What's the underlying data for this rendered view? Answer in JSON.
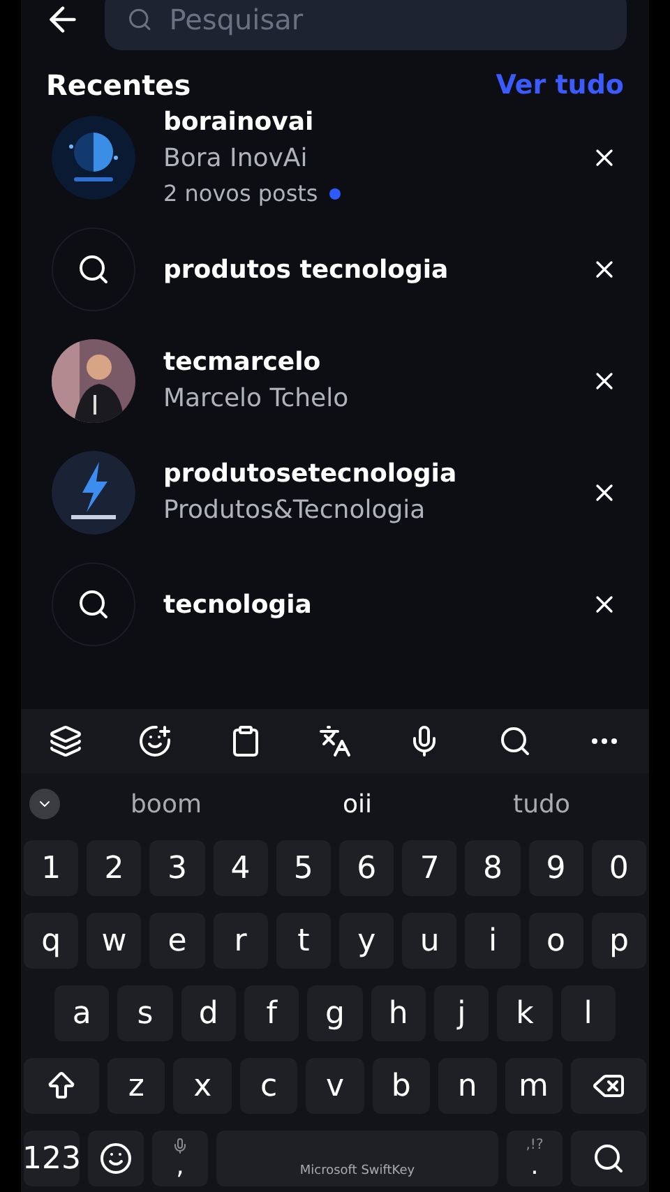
{
  "search": {
    "placeholder": "Pesquisar"
  },
  "recent": {
    "title": "Recentes",
    "see_all": "Ver tudo",
    "items": [
      {
        "kind": "account",
        "username": "borainovai",
        "name": "Bora InovAi",
        "note": "2 novos posts"
      },
      {
        "kind": "search",
        "query": "produtos tecnologia"
      },
      {
        "kind": "account",
        "username": "tecmarcelo",
        "name": "Marcelo Tchelo"
      },
      {
        "kind": "account",
        "username": "produtosetecnologia",
        "name": "Produtos&Tecnologia"
      },
      {
        "kind": "search",
        "query": "tecnologia"
      }
    ]
  },
  "keyboard": {
    "suggestions": [
      "boom",
      "oii",
      "tudo"
    ],
    "rows": [
      [
        "1",
        "2",
        "3",
        "4",
        "5",
        "6",
        "7",
        "8",
        "9",
        "0"
      ],
      [
        "q",
        "w",
        "e",
        "r",
        "t",
        "y",
        "u",
        "i",
        "o",
        "p"
      ],
      [
        "a",
        "s",
        "d",
        "f",
        "g",
        "h",
        "j",
        "k",
        "l"
      ],
      [
        "z",
        "x",
        "c",
        "v",
        "b",
        "n",
        "m"
      ]
    ],
    "bottom": {
      "numbers": "123",
      "comma": ",",
      "space": "Microsoft SwiftKey",
      "punct_hint": ",!?",
      "period": "."
    }
  }
}
